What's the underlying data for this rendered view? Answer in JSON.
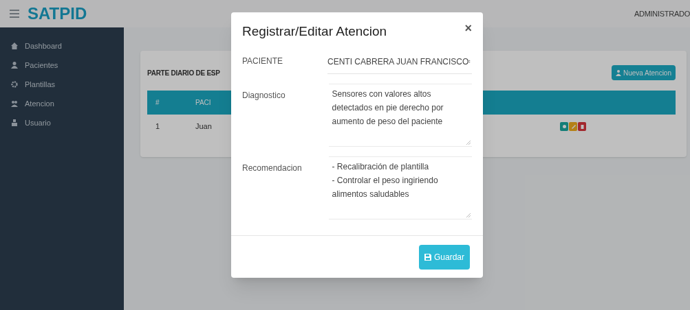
{
  "header": {
    "logo": "SATPID",
    "user": "ADMINISTRADO"
  },
  "sidebar": {
    "items": [
      {
        "label": "Dashboard",
        "selected": false
      },
      {
        "label": "Pacientes",
        "selected": false
      },
      {
        "label": "Plantillas",
        "selected": false
      },
      {
        "label": "Atencion",
        "selected": false
      },
      {
        "label": "Usuario",
        "selected": false
      }
    ]
  },
  "card": {
    "title": "PARTE DIARIO DE ESP",
    "new_button": "Nueva Atencion",
    "table": {
      "columns": [
        "#",
        "PACI"
      ],
      "rows": [
        {
          "cells": [
            "1",
            "Juan"
          ],
          "actions": [
            {
              "kind": "view"
            },
            {
              "kind": "edit"
            },
            {
              "kind": "delete"
            }
          ]
        }
      ]
    }
  },
  "modal": {
    "title": "Registrar/Editar Atencion",
    "close": "×",
    "fields": [
      {
        "kind": "select",
        "label": "PACIENTE",
        "value": "CENTI CABRERA JUAN FRANCISCO"
      },
      {
        "kind": "textarea",
        "label": "Diagnostico",
        "value": "Sensores con valores altos detectados en pie derecho por aumento de peso del paciente"
      },
      {
        "kind": "textarea",
        "label": "Recomendacion",
        "value": "- Recalibración de plantilla\n- Controlar el peso ingiriendo alimentos saludables"
      }
    ],
    "save_button": "Guardar"
  }
}
